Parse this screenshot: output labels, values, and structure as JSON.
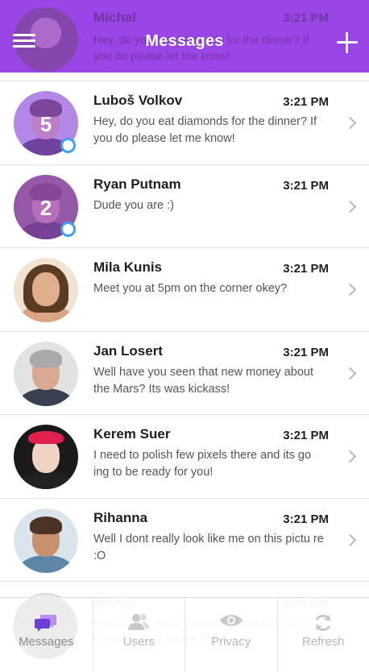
{
  "header": {
    "title": "Messages",
    "background_color": "#9a46e6",
    "left_icon": "hamburger-menu-icon",
    "right_icon": "plus-icon",
    "ghost_row": {
      "name": "Michal",
      "time": "3:21 PM",
      "message": "Hey, do you eat diamonds for the dinner? If you do please let me know!"
    }
  },
  "conversations": [
    {
      "name": "Luboš Volkov",
      "time": "3:21 PM",
      "message": "Hey, do you eat diamonds for the dinner? If you do please let me know!",
      "unread": "5",
      "online": true
    },
    {
      "name": "Ryan Putnam",
      "time": "3:21 PM",
      "message": "Dude you are :)",
      "unread": "2",
      "online": true
    },
    {
      "name": "Mila Kunis",
      "time": "3:21 PM",
      "message": "Meet you at 5pm on the corner okey?"
    },
    {
      "name": "Jan Losert",
      "time": "3:21 PM",
      "message": "Well have you seen that new money about the Mars? Its was kickass!"
    },
    {
      "name": "Kerem Suer",
      "time": "3:21 PM",
      "message": "I need to polish few pixels there and its go ing to be ready for you!"
    },
    {
      "name": "Rihanna",
      "time": "3:21 PM",
      "message": "Well I dont really look like me on this pictu re :O"
    }
  ],
  "ghost_bottom_row": {
    "name": "Michal",
    "time": "3:21 PM",
    "message": "Hey, do you eat diamonds for the dinner? If you do please let me know!"
  },
  "tabbar": {
    "tabs": [
      {
        "label": "Messages",
        "icon": "chat-bubbles-icon",
        "active": true
      },
      {
        "label": "Users",
        "icon": "users-icon"
      },
      {
        "label": "Privacy",
        "icon": "eye-icon"
      },
      {
        "label": "Refresh",
        "icon": "refresh-icon"
      }
    ]
  },
  "colors": {
    "accent": "#9a46e6",
    "online_indicator": "#3da0f5",
    "inactive_tab_text": "#b7b7b7"
  }
}
